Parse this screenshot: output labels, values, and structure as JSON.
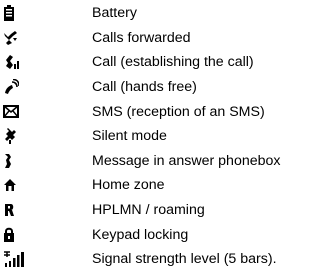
{
  "legend": {
    "items": [
      {
        "icon": "battery-icon",
        "label": "Battery"
      },
      {
        "icon": "calls-forwarded-icon",
        "label": "Calls forwarded"
      },
      {
        "icon": "call-establishing-icon",
        "label": "Call (establishing the call)"
      },
      {
        "icon": "call-hands-free-icon",
        "label": "Call (hands free)"
      },
      {
        "icon": "envelope-icon",
        "label": "SMS (reception of an SMS)"
      },
      {
        "icon": "silent-mode-icon",
        "label": "Silent mode"
      },
      {
        "icon": "answer-phonebox-icon",
        "label": "Message in answer phonebox"
      },
      {
        "icon": "home-zone-icon",
        "label": "Home zone"
      },
      {
        "icon": "hplmn-roaming-icon",
        "label": "HPLMN / roaming"
      },
      {
        "icon": "padlock-icon",
        "label": "Keypad locking"
      },
      {
        "icon": "signal-strength-icon",
        "label": "Signal strength level (5 bars)."
      }
    ]
  }
}
